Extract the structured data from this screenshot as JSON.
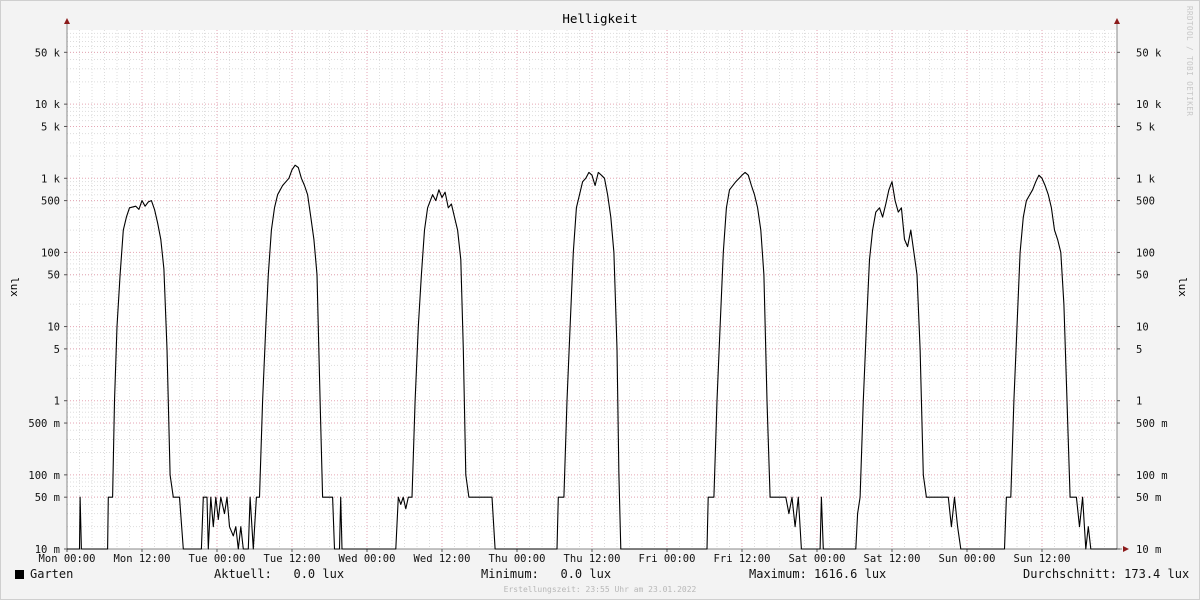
{
  "chart_data": {
    "type": "line",
    "title": "Helligkeit",
    "ylabel": "lux",
    "ylabel_right": "lux",
    "y_scale": "log",
    "ylim": [
      0.01,
      100000
    ],
    "y_ticks": [
      {
        "v": 0.01,
        "label": "10 m"
      },
      {
        "v": 0.05,
        "label": "50 m"
      },
      {
        "v": 0.1,
        "label": "100 m"
      },
      {
        "v": 0.5,
        "label": "500 m"
      },
      {
        "v": 1,
        "label": "1"
      },
      {
        "v": 5,
        "label": "5"
      },
      {
        "v": 10,
        "label": "10"
      },
      {
        "v": 50,
        "label": "50"
      },
      {
        "v": 100,
        "label": "100"
      },
      {
        "v": 500,
        "label": "500"
      },
      {
        "v": 1000,
        "label": "1 k"
      },
      {
        "v": 5000,
        "label": "5 k"
      },
      {
        "v": 10000,
        "label": "10 k"
      },
      {
        "v": 50000,
        "label": "50 k"
      }
    ],
    "xlim": [
      0,
      168
    ],
    "x_ticks": [
      {
        "v": 0,
        "label": "Mon 00:00"
      },
      {
        "v": 12,
        "label": "Mon 12:00"
      },
      {
        "v": 24,
        "label": "Tue 00:00"
      },
      {
        "v": 36,
        "label": "Tue 12:00"
      },
      {
        "v": 48,
        "label": "Wed 00:00"
      },
      {
        "v": 60,
        "label": "Wed 12:00"
      },
      {
        "v": 72,
        "label": "Thu 00:00"
      },
      {
        "v": 84,
        "label": "Thu 12:00"
      },
      {
        "v": 96,
        "label": "Fri 00:00"
      },
      {
        "v": 108,
        "label": "Fri 12:00"
      },
      {
        "v": 120,
        "label": "Sat 00:00"
      },
      {
        "v": 132,
        "label": "Sat 12:00"
      },
      {
        "v": 144,
        "label": "Sun 00:00"
      },
      {
        "v": 156,
        "label": "Sun 12:00"
      }
    ],
    "grid": true,
    "series": [
      {
        "name": "Garten",
        "color": "#000000",
        "points": [
          [
            0,
            0.01
          ],
          [
            2,
            0.01
          ],
          [
            2.1,
            0.05
          ],
          [
            2.3,
            0.01
          ],
          [
            6.5,
            0.01
          ],
          [
            6.6,
            0.05
          ],
          [
            7.3,
            0.05
          ],
          [
            7.6,
            1
          ],
          [
            8,
            10
          ],
          [
            8.5,
            50
          ],
          [
            9,
            200
          ],
          [
            9.5,
            300
          ],
          [
            10,
            400
          ],
          [
            11,
            420
          ],
          [
            11.5,
            380
          ],
          [
            12,
            500
          ],
          [
            12.5,
            420
          ],
          [
            13,
            480
          ],
          [
            13.5,
            500
          ],
          [
            14,
            380
          ],
          [
            14.5,
            250
          ],
          [
            15,
            150
          ],
          [
            15.5,
            60
          ],
          [
            16,
            5
          ],
          [
            16.5,
            0.1
          ],
          [
            17,
            0.05
          ],
          [
            18,
            0.05
          ],
          [
            18.6,
            0.01
          ],
          [
            21.5,
            0.01
          ],
          [
            21.8,
            0.05
          ],
          [
            22.4,
            0.05
          ],
          [
            22.6,
            0.01
          ],
          [
            23,
            0.05
          ],
          [
            23.4,
            0.02
          ],
          [
            23.8,
            0.05
          ],
          [
            24.2,
            0.025
          ],
          [
            24.6,
            0.05
          ],
          [
            25.2,
            0.03
          ],
          [
            25.6,
            0.05
          ],
          [
            26,
            0.02
          ],
          [
            26.6,
            0.015
          ],
          [
            27,
            0.02
          ],
          [
            27.4,
            0.01
          ],
          [
            27.8,
            0.02
          ],
          [
            28.2,
            0.01
          ],
          [
            29,
            0.01
          ],
          [
            29.3,
            0.05
          ],
          [
            29.8,
            0.01
          ],
          [
            30.3,
            0.05
          ],
          [
            30.8,
            0.05
          ],
          [
            31.3,
            1
          ],
          [
            31.8,
            10
          ],
          [
            32.2,
            50
          ],
          [
            32.7,
            200
          ],
          [
            33.2,
            400
          ],
          [
            33.7,
            600
          ],
          [
            34.5,
            800
          ],
          [
            35.5,
            1000
          ],
          [
            36,
            1300
          ],
          [
            36.5,
            1500
          ],
          [
            37,
            1400
          ],
          [
            37.5,
            1000
          ],
          [
            38,
            800
          ],
          [
            38.5,
            600
          ],
          [
            39,
            300
          ],
          [
            39.5,
            150
          ],
          [
            40,
            50
          ],
          [
            40.5,
            1
          ],
          [
            40.9,
            0.05
          ],
          [
            42,
            0.05
          ],
          [
            42.5,
            0.05
          ],
          [
            42.8,
            0.01
          ],
          [
            43.6,
            0.01
          ],
          [
            43.8,
            0.05
          ],
          [
            44,
            0.01
          ],
          [
            52.6,
            0.01
          ],
          [
            53,
            0.05
          ],
          [
            53.4,
            0.04
          ],
          [
            53.8,
            0.05
          ],
          [
            54.2,
            0.035
          ],
          [
            54.6,
            0.05
          ],
          [
            55.2,
            0.05
          ],
          [
            55.7,
            1
          ],
          [
            56.2,
            10
          ],
          [
            56.7,
            50
          ],
          [
            57.2,
            200
          ],
          [
            57.7,
            400
          ],
          [
            58.5,
            600
          ],
          [
            59,
            500
          ],
          [
            59.5,
            700
          ],
          [
            60,
            550
          ],
          [
            60.5,
            650
          ],
          [
            61,
            400
          ],
          [
            61.5,
            450
          ],
          [
            62,
            300
          ],
          [
            62.5,
            200
          ],
          [
            63,
            80
          ],
          [
            63.4,
            5
          ],
          [
            63.8,
            0.1
          ],
          [
            64.3,
            0.05
          ],
          [
            68,
            0.05
          ],
          [
            68.5,
            0.01
          ],
          [
            78.4,
            0.01
          ],
          [
            78.6,
            0.05
          ],
          [
            79.5,
            0.05
          ],
          [
            80,
            1
          ],
          [
            80.5,
            10
          ],
          [
            81,
            100
          ],
          [
            81.5,
            400
          ],
          [
            82,
            600
          ],
          [
            82.5,
            900
          ],
          [
            83,
            1000
          ],
          [
            83.5,
            1200
          ],
          [
            84,
            1100
          ],
          [
            84.5,
            800
          ],
          [
            85,
            1200
          ],
          [
            85.5,
            1100
          ],
          [
            86,
            1000
          ],
          [
            86.5,
            600
          ],
          [
            87,
            300
          ],
          [
            87.5,
            100
          ],
          [
            88,
            5
          ],
          [
            88.3,
            0.1
          ],
          [
            88.6,
            0.01
          ],
          [
            102.4,
            0.01
          ],
          [
            102.6,
            0.05
          ],
          [
            103.5,
            0.05
          ],
          [
            104,
            1
          ],
          [
            104.5,
            10
          ],
          [
            105,
            100
          ],
          [
            105.5,
            400
          ],
          [
            106,
            700
          ],
          [
            107,
            900
          ],
          [
            108,
            1100
          ],
          [
            108.5,
            1200
          ],
          [
            109,
            1100
          ],
          [
            109.5,
            800
          ],
          [
            110,
            600
          ],
          [
            110.5,
            400
          ],
          [
            111,
            200
          ],
          [
            111.5,
            50
          ],
          [
            112,
            1
          ],
          [
            112.5,
            0.05
          ],
          [
            115,
            0.05
          ],
          [
            115.5,
            0.03
          ],
          [
            116,
            0.05
          ],
          [
            116.5,
            0.02
          ],
          [
            117,
            0.05
          ],
          [
            117.5,
            0.01
          ],
          [
            120.5,
            0.01
          ],
          [
            120.7,
            0.05
          ],
          [
            121,
            0.01
          ],
          [
            126.2,
            0.01
          ],
          [
            126.5,
            0.03
          ],
          [
            126.9,
            0.05
          ],
          [
            127.4,
            1
          ],
          [
            127.9,
            10
          ],
          [
            128.4,
            80
          ],
          [
            128.9,
            200
          ],
          [
            129.4,
            350
          ],
          [
            130,
            400
          ],
          [
            130.5,
            300
          ],
          [
            131,
            450
          ],
          [
            131.5,
            700
          ],
          [
            132,
            900
          ],
          [
            132.5,
            500
          ],
          [
            133,
            350
          ],
          [
            133.5,
            400
          ],
          [
            134,
            150
          ],
          [
            134.5,
            120
          ],
          [
            135,
            200
          ],
          [
            135.5,
            100
          ],
          [
            136,
            50
          ],
          [
            136.5,
            5
          ],
          [
            137,
            0.1
          ],
          [
            137.5,
            0.05
          ],
          [
            141,
            0.05
          ],
          [
            141.5,
            0.02
          ],
          [
            142,
            0.05
          ],
          [
            142.5,
            0.02
          ],
          [
            143,
            0.01
          ],
          [
            150,
            0.01
          ],
          [
            150.3,
            0.05
          ],
          [
            151,
            0.05
          ],
          [
            151.5,
            1
          ],
          [
            152,
            10
          ],
          [
            152.5,
            100
          ],
          [
            153,
            300
          ],
          [
            153.5,
            500
          ],
          [
            154.5,
            700
          ],
          [
            155,
            900
          ],
          [
            155.5,
            1100
          ],
          [
            156,
            1000
          ],
          [
            156.5,
            800
          ],
          [
            157,
            600
          ],
          [
            157.5,
            400
          ],
          [
            158,
            200
          ],
          [
            158.5,
            150
          ],
          [
            159,
            100
          ],
          [
            159.5,
            20
          ],
          [
            160,
            1
          ],
          [
            160.5,
            0.05
          ],
          [
            161.5,
            0.05
          ],
          [
            162,
            0.02
          ],
          [
            162.5,
            0.05
          ],
          [
            163,
            0.01
          ],
          [
            163.4,
            0.02
          ],
          [
            163.8,
            0.01
          ],
          [
            168,
            0.01
          ]
        ]
      }
    ]
  },
  "legend": {
    "series_name": "Garten",
    "current": "Aktuell:   0.0 lux",
    "minimum": "Minimum:   0.0 lux",
    "maximum": "Maximum: 1616.6 lux",
    "average": "Durchschnitt: 173.4 lux"
  },
  "footer": "Erstellungszeit: 23:55 Uhr am 23.01.2022",
  "watermark": "RRDTOOL / TOBI OETIKER"
}
